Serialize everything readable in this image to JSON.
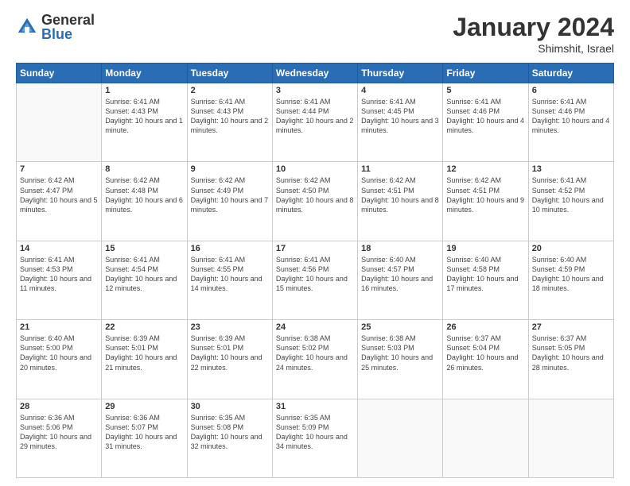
{
  "logo": {
    "general": "General",
    "blue": "Blue"
  },
  "header": {
    "month": "January 2024",
    "location": "Shimshit, Israel"
  },
  "weekdays": [
    "Sunday",
    "Monday",
    "Tuesday",
    "Wednesday",
    "Thursday",
    "Friday",
    "Saturday"
  ],
  "weeks": [
    [
      {
        "day": "",
        "sunrise": "",
        "sunset": "",
        "daylight": ""
      },
      {
        "day": "1",
        "sunrise": "Sunrise: 6:41 AM",
        "sunset": "Sunset: 4:43 PM",
        "daylight": "Daylight: 10 hours and 1 minute."
      },
      {
        "day": "2",
        "sunrise": "Sunrise: 6:41 AM",
        "sunset": "Sunset: 4:43 PM",
        "daylight": "Daylight: 10 hours and 2 minutes."
      },
      {
        "day": "3",
        "sunrise": "Sunrise: 6:41 AM",
        "sunset": "Sunset: 4:44 PM",
        "daylight": "Daylight: 10 hours and 2 minutes."
      },
      {
        "day": "4",
        "sunrise": "Sunrise: 6:41 AM",
        "sunset": "Sunset: 4:45 PM",
        "daylight": "Daylight: 10 hours and 3 minutes."
      },
      {
        "day": "5",
        "sunrise": "Sunrise: 6:41 AM",
        "sunset": "Sunset: 4:46 PM",
        "daylight": "Daylight: 10 hours and 4 minutes."
      },
      {
        "day": "6",
        "sunrise": "Sunrise: 6:41 AM",
        "sunset": "Sunset: 4:46 PM",
        "daylight": "Daylight: 10 hours and 4 minutes."
      }
    ],
    [
      {
        "day": "7",
        "sunrise": "Sunrise: 6:42 AM",
        "sunset": "Sunset: 4:47 PM",
        "daylight": "Daylight: 10 hours and 5 minutes."
      },
      {
        "day": "8",
        "sunrise": "Sunrise: 6:42 AM",
        "sunset": "Sunset: 4:48 PM",
        "daylight": "Daylight: 10 hours and 6 minutes."
      },
      {
        "day": "9",
        "sunrise": "Sunrise: 6:42 AM",
        "sunset": "Sunset: 4:49 PM",
        "daylight": "Daylight: 10 hours and 7 minutes."
      },
      {
        "day": "10",
        "sunrise": "Sunrise: 6:42 AM",
        "sunset": "Sunset: 4:50 PM",
        "daylight": "Daylight: 10 hours and 8 minutes."
      },
      {
        "day": "11",
        "sunrise": "Sunrise: 6:42 AM",
        "sunset": "Sunset: 4:51 PM",
        "daylight": "Daylight: 10 hours and 8 minutes."
      },
      {
        "day": "12",
        "sunrise": "Sunrise: 6:42 AM",
        "sunset": "Sunset: 4:51 PM",
        "daylight": "Daylight: 10 hours and 9 minutes."
      },
      {
        "day": "13",
        "sunrise": "Sunrise: 6:41 AM",
        "sunset": "Sunset: 4:52 PM",
        "daylight": "Daylight: 10 hours and 10 minutes."
      }
    ],
    [
      {
        "day": "14",
        "sunrise": "Sunrise: 6:41 AM",
        "sunset": "Sunset: 4:53 PM",
        "daylight": "Daylight: 10 hours and 11 minutes."
      },
      {
        "day": "15",
        "sunrise": "Sunrise: 6:41 AM",
        "sunset": "Sunset: 4:54 PM",
        "daylight": "Daylight: 10 hours and 12 minutes."
      },
      {
        "day": "16",
        "sunrise": "Sunrise: 6:41 AM",
        "sunset": "Sunset: 4:55 PM",
        "daylight": "Daylight: 10 hours and 14 minutes."
      },
      {
        "day": "17",
        "sunrise": "Sunrise: 6:41 AM",
        "sunset": "Sunset: 4:56 PM",
        "daylight": "Daylight: 10 hours and 15 minutes."
      },
      {
        "day": "18",
        "sunrise": "Sunrise: 6:40 AM",
        "sunset": "Sunset: 4:57 PM",
        "daylight": "Daylight: 10 hours and 16 minutes."
      },
      {
        "day": "19",
        "sunrise": "Sunrise: 6:40 AM",
        "sunset": "Sunset: 4:58 PM",
        "daylight": "Daylight: 10 hours and 17 minutes."
      },
      {
        "day": "20",
        "sunrise": "Sunrise: 6:40 AM",
        "sunset": "Sunset: 4:59 PM",
        "daylight": "Daylight: 10 hours and 18 minutes."
      }
    ],
    [
      {
        "day": "21",
        "sunrise": "Sunrise: 6:40 AM",
        "sunset": "Sunset: 5:00 PM",
        "daylight": "Daylight: 10 hours and 20 minutes."
      },
      {
        "day": "22",
        "sunrise": "Sunrise: 6:39 AM",
        "sunset": "Sunset: 5:01 PM",
        "daylight": "Daylight: 10 hours and 21 minutes."
      },
      {
        "day": "23",
        "sunrise": "Sunrise: 6:39 AM",
        "sunset": "Sunset: 5:01 PM",
        "daylight": "Daylight: 10 hours and 22 minutes."
      },
      {
        "day": "24",
        "sunrise": "Sunrise: 6:38 AM",
        "sunset": "Sunset: 5:02 PM",
        "daylight": "Daylight: 10 hours and 24 minutes."
      },
      {
        "day": "25",
        "sunrise": "Sunrise: 6:38 AM",
        "sunset": "Sunset: 5:03 PM",
        "daylight": "Daylight: 10 hours and 25 minutes."
      },
      {
        "day": "26",
        "sunrise": "Sunrise: 6:37 AM",
        "sunset": "Sunset: 5:04 PM",
        "daylight": "Daylight: 10 hours and 26 minutes."
      },
      {
        "day": "27",
        "sunrise": "Sunrise: 6:37 AM",
        "sunset": "Sunset: 5:05 PM",
        "daylight": "Daylight: 10 hours and 28 minutes."
      }
    ],
    [
      {
        "day": "28",
        "sunrise": "Sunrise: 6:36 AM",
        "sunset": "Sunset: 5:06 PM",
        "daylight": "Daylight: 10 hours and 29 minutes."
      },
      {
        "day": "29",
        "sunrise": "Sunrise: 6:36 AM",
        "sunset": "Sunset: 5:07 PM",
        "daylight": "Daylight: 10 hours and 31 minutes."
      },
      {
        "day": "30",
        "sunrise": "Sunrise: 6:35 AM",
        "sunset": "Sunset: 5:08 PM",
        "daylight": "Daylight: 10 hours and 32 minutes."
      },
      {
        "day": "31",
        "sunrise": "Sunrise: 6:35 AM",
        "sunset": "Sunset: 5:09 PM",
        "daylight": "Daylight: 10 hours and 34 minutes."
      },
      {
        "day": "",
        "sunrise": "",
        "sunset": "",
        "daylight": ""
      },
      {
        "day": "",
        "sunrise": "",
        "sunset": "",
        "daylight": ""
      },
      {
        "day": "",
        "sunrise": "",
        "sunset": "",
        "daylight": ""
      }
    ]
  ]
}
